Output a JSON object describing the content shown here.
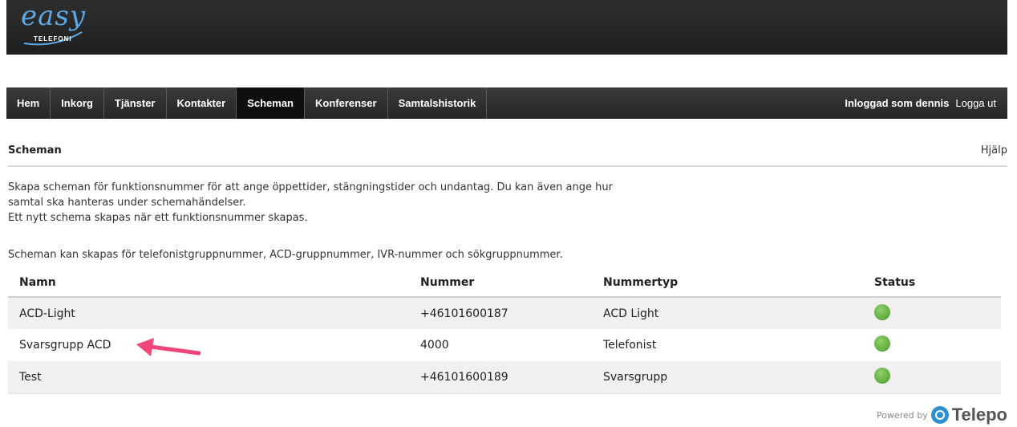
{
  "brand": {
    "logo_text": "easy",
    "logo_sub": "TELEFONI"
  },
  "nav": {
    "items": [
      {
        "label": "Hem"
      },
      {
        "label": "Inkorg"
      },
      {
        "label": "Tjänster"
      },
      {
        "label": "Kontakter"
      },
      {
        "label": "Scheman",
        "active": true
      },
      {
        "label": "Konferenser"
      },
      {
        "label": "Samtalshistorik"
      }
    ],
    "user_text": "Inloggad som dennis",
    "logout_label": "Logga ut"
  },
  "page": {
    "title": "Scheman",
    "help_label": "Hjälp",
    "description_lines": [
      "Skapa scheman för funktionsnummer för att ange öppettider, stängningstider och undantag. Du kan även ange hur",
      "samtal ska hanteras under schemahändelser.",
      "Ett nytt schema skapas när ett funktionsnummer skapas."
    ],
    "note": "Scheman kan skapas för telefonistgruppnummer, ACD-gruppnummer, IVR-nummer och sökgruppnummer."
  },
  "table": {
    "headers": {
      "name": "Namn",
      "number": "Nummer",
      "type": "Nummertyp",
      "status": "Status"
    },
    "rows": [
      {
        "name": "ACD-Light",
        "number": "+46101600187",
        "type": "ACD Light",
        "status": "active",
        "status_color": "#5cb33a"
      },
      {
        "name": "Svarsgrupp ACD",
        "number": "4000",
        "type": "Telefonist",
        "status": "active",
        "status_color": "#5cb33a"
      },
      {
        "name": "Test",
        "number": "+46101600189",
        "type": "Svarsgrupp",
        "status": "active",
        "status_color": "#5cb33a"
      }
    ]
  },
  "annotation": {
    "arrow_color": "#f0467a",
    "icon": "pink-arrow-icon"
  },
  "footer": {
    "powered_label": "Powered by",
    "brand": "Telepo"
  },
  "colors": {
    "topbar": "#262626",
    "nav_active": "#0f0f0f",
    "accent_logo": "#5aa9e6"
  }
}
